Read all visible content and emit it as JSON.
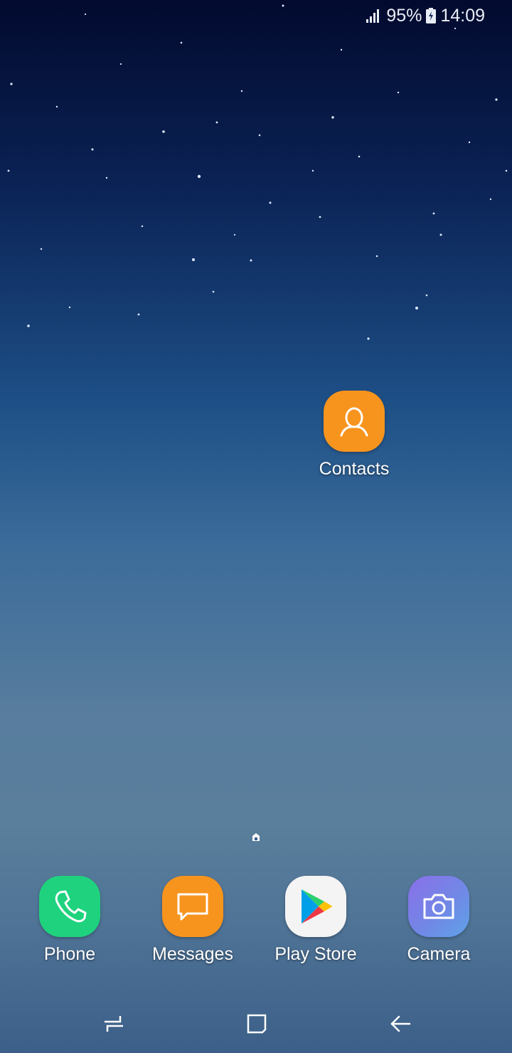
{
  "status_bar": {
    "battery_percent": "95%",
    "time": "14:09",
    "icons": [
      "signal-icon",
      "battery-charging-icon"
    ]
  },
  "home_screen": {
    "apps": [
      {
        "label": "Contacts",
        "icon": "contacts-icon",
        "color": "#f7941d"
      }
    ],
    "page_indicator_icon": "home-page-indicator-icon"
  },
  "dock": {
    "apps": [
      {
        "label": "Phone",
        "icon": "phone-icon",
        "color": "#1fd27e"
      },
      {
        "label": "Messages",
        "icon": "messages-icon",
        "color": "#f7941d"
      },
      {
        "label": "Play Store",
        "icon": "play-store-icon",
        "color": "#f4f4f4"
      },
      {
        "label": "Camera",
        "icon": "camera-icon",
        "color": "#7a72e6"
      }
    ]
  },
  "nav_bar": {
    "buttons": [
      "recent-apps-icon",
      "home-icon",
      "back-icon"
    ]
  }
}
